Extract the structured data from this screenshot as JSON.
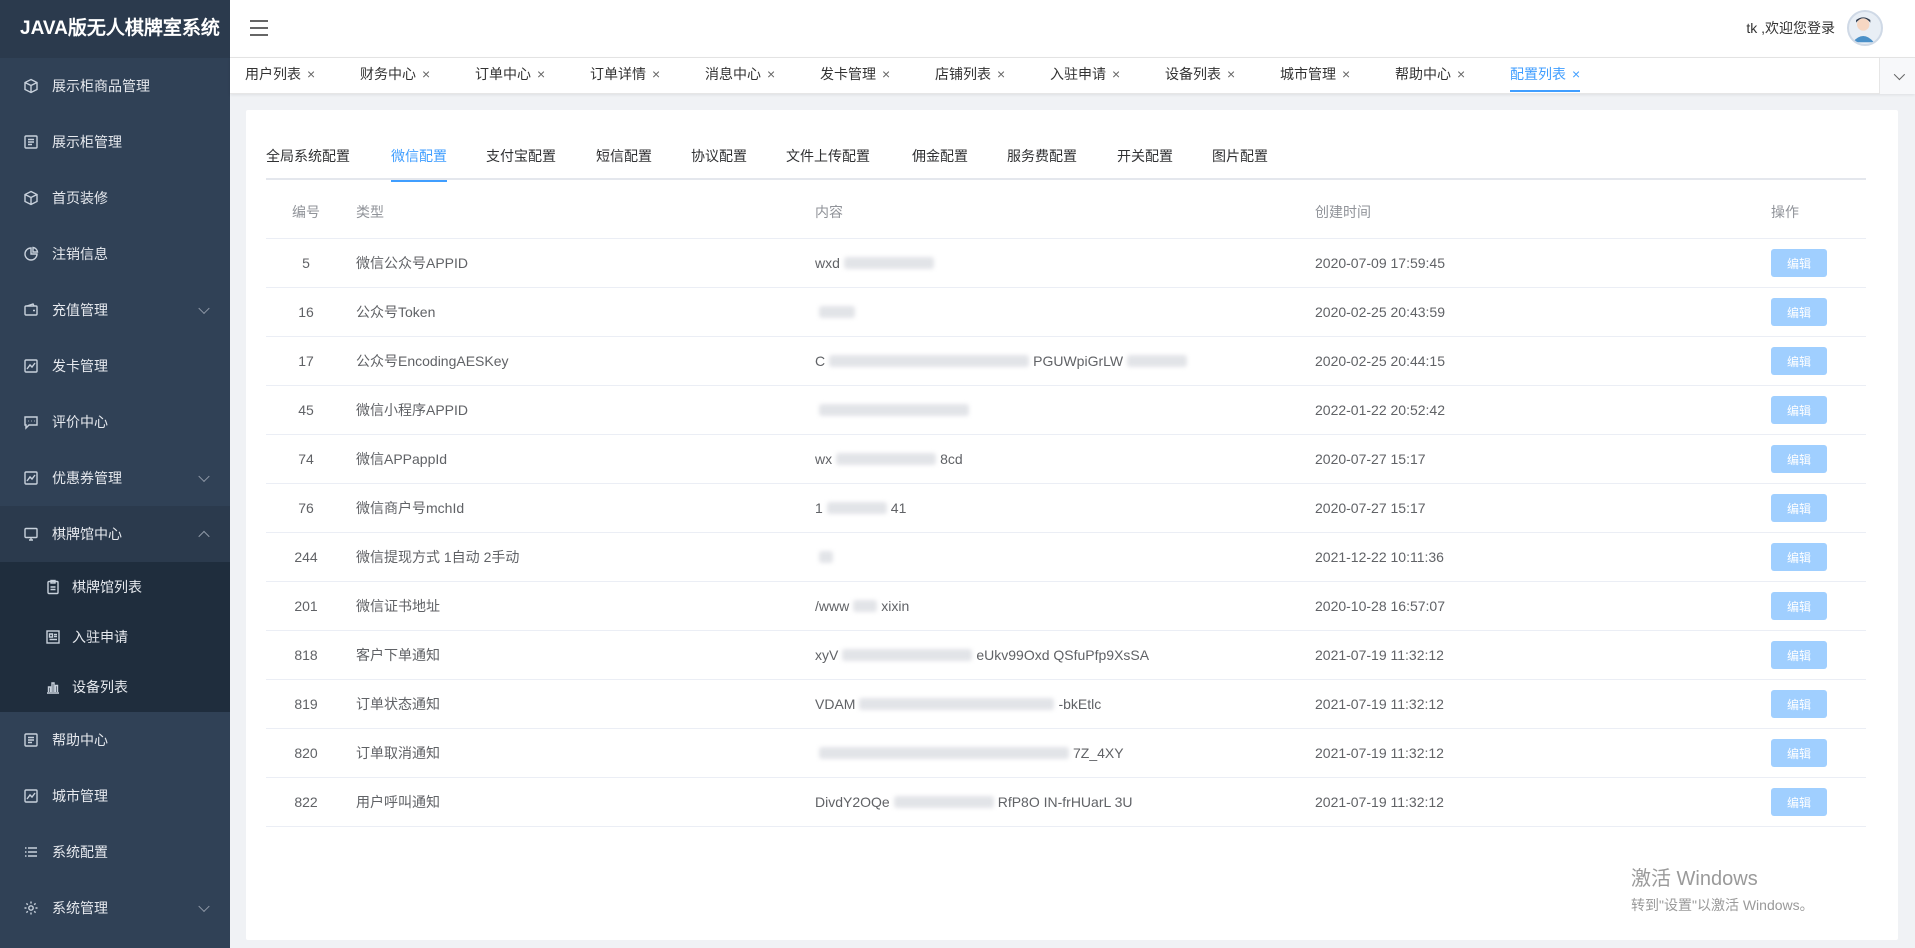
{
  "app": {
    "title": "JAVA版无人棋牌室系统"
  },
  "header": {
    "greeting": "tk ,欢迎您登录"
  },
  "sidebar": {
    "items": [
      {
        "label": "展示柜商品管理",
        "icon": "cube-icon"
      },
      {
        "label": "展示柜管理",
        "icon": "list-icon"
      },
      {
        "label": "首页装修",
        "icon": "cube-icon"
      },
      {
        "label": "注销信息",
        "icon": "pie-icon"
      },
      {
        "label": "充值管理",
        "icon": "wallet-icon",
        "expandable": true
      },
      {
        "label": "发卡管理",
        "icon": "chart-icon"
      },
      {
        "label": "评价中心",
        "icon": "chat-icon"
      },
      {
        "label": "优惠券管理",
        "icon": "chart-icon",
        "expandable": true
      },
      {
        "label": "棋牌馆中心",
        "icon": "monitor-icon",
        "expanded": true
      },
      {
        "label": "帮助中心",
        "icon": "list-icon"
      },
      {
        "label": "城市管理",
        "icon": "chart-icon"
      },
      {
        "label": "系统配置",
        "icon": "menu-icon"
      },
      {
        "label": "系统管理",
        "icon": "gear-icon",
        "expandable": true
      }
    ],
    "submenu": [
      {
        "label": "棋牌馆列表",
        "icon": "clipboard-icon"
      },
      {
        "label": "入驻申请",
        "icon": "form-icon"
      },
      {
        "label": "设备列表",
        "icon": "bar-chart-icon"
      }
    ]
  },
  "tabs": [
    {
      "label": "用户列表",
      "close": "×"
    },
    {
      "label": "财务中心",
      "close": "×"
    },
    {
      "label": "订单中心",
      "close": "×"
    },
    {
      "label": "订单详情",
      "close": "×"
    },
    {
      "label": "消息中心",
      "close": "×"
    },
    {
      "label": "发卡管理",
      "close": "×"
    },
    {
      "label": "店铺列表",
      "close": "×"
    },
    {
      "label": "入驻申请",
      "close": "×"
    },
    {
      "label": "设备列表",
      "close": "×"
    },
    {
      "label": "城市管理",
      "close": "×"
    },
    {
      "label": "帮助中心",
      "close": "×"
    },
    {
      "label": "配置列表",
      "close": "×",
      "active": true
    }
  ],
  "config_tabs": [
    {
      "label": "全局系统配置"
    },
    {
      "label": "微信配置",
      "active": true
    },
    {
      "label": "支付宝配置"
    },
    {
      "label": "短信配置"
    },
    {
      "label": "协议配置"
    },
    {
      "label": "文件上传配置"
    },
    {
      "label": "佣金配置"
    },
    {
      "label": "服务费配置"
    },
    {
      "label": "开关配置"
    },
    {
      "label": "图片配置"
    }
  ],
  "table": {
    "headers": {
      "id": "编号",
      "type": "类型",
      "content": "内容",
      "time": "创建时间",
      "op": "操作"
    },
    "edit_label": "编辑",
    "rows": [
      {
        "id": "5",
        "type": "微信公众号APPID",
        "content_pre": "wxd",
        "content_post": "",
        "time": "2020-07-09 17:59:45"
      },
      {
        "id": "16",
        "type": "公众号Token",
        "content_pre": "",
        "content_post": "",
        "time": "2020-02-25 20:43:59"
      },
      {
        "id": "17",
        "type": "公众号EncodingAESKey",
        "content_pre": "C",
        "content_post": "PGUWpiGrLW",
        "time": "2020-02-25 20:44:15"
      },
      {
        "id": "45",
        "type": "微信小程序APPID",
        "content_pre": "",
        "content_post": "",
        "time": "2022-01-22 20:52:42"
      },
      {
        "id": "74",
        "type": "微信APPappId",
        "content_pre": "wx",
        "content_post": "8cd",
        "time": "2020-07-27 15:17"
      },
      {
        "id": "76",
        "type": "微信商户号mchId",
        "content_pre": "1",
        "content_post": "41",
        "time": "2020-07-27 15:17"
      },
      {
        "id": "244",
        "type": "微信提现方式 1自动 2手动",
        "content_pre": "",
        "content_post": "",
        "time": "2021-12-22 10:11:36"
      },
      {
        "id": "201",
        "type": "微信证书地址",
        "content_pre": "/www",
        "content_post": "xixin",
        "time": "2020-10-28 16:57:07"
      },
      {
        "id": "818",
        "type": "客户下单通知",
        "content_pre": "xyV",
        "content_post": "eUkv99Oxd QSfuPfp9XsSA",
        "time": "2021-07-19 11:32:12"
      },
      {
        "id": "819",
        "type": "订单状态通知",
        "content_pre": "VDAM",
        "content_post": "-bkEtlc",
        "time": "2021-07-19 11:32:12"
      },
      {
        "id": "820",
        "type": "订单取消通知",
        "content_pre": "",
        "content_post": "7Z_4XY",
        "time": "2021-07-19 11:32:12"
      },
      {
        "id": "822",
        "type": "用户呼叫通知",
        "content_pre": "DivdY2OQe",
        "content_post": "RfP8O IN-frHUarL 3U",
        "time": "2021-07-19 11:32:12"
      }
    ]
  },
  "watermark": {
    "line1": "激活 Windows",
    "line2": "转到\"设置\"以激活 Windows。"
  },
  "colors": {
    "sidebar": "#304156",
    "accent": "#409eff",
    "edit_button": "#a0cfff"
  }
}
